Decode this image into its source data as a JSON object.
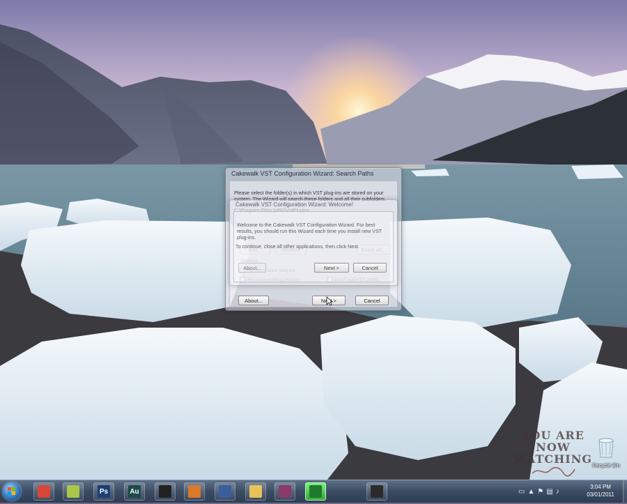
{
  "colors": {
    "sky_top": "#8a86b5",
    "sky_glow": "#f7e6c8",
    "lake": "#6f9199",
    "ice": "#e9f2f8",
    "taskbar": "#3b4c63",
    "active_task": "#4cc04f"
  },
  "wizard_back": {
    "title": "Cakewalk VST Configuration Wizard: Search Paths",
    "instructions": "Please select the folder(s) in which VST plug-ins are stored on your system. The Wizard will search these folders and all their subfolders.",
    "path_value": "C:\\Program Files (x86)\\VstPlugins",
    "add_label": "Add...",
    "remove_label": "Remove",
    "reset_label": "Reset all...",
    "options_group_label": "Options",
    "option_rescan_failed": "Re-scan failed plug-ins",
    "option_rescan_existing": "Re-scan existing plug-ins",
    "option_no_vst_prefix": "Don't add VST prefix",
    "about_label": "About...",
    "next_label": "Next >",
    "cancel_label": "Cancel"
  },
  "wizard_front": {
    "title": "Cakewalk VST Configuration Wizard: Welcome!",
    "welcome_text": "Welcome to the Cakewalk VST Configuration Wizard. For best results, you should run this Wizard each time you install new VST plug-ins.",
    "continue_text": "To continue, close all other applications, then click Next.",
    "about_label": "About...",
    "next_label": "Next >",
    "cancel_label": "Cancel"
  },
  "desktop": {
    "recycle_bin_label": "Recycle Bin",
    "watermark_line1": "YOU ARE NOW",
    "watermark_line2": "WATCHING"
  },
  "taskbar": {
    "apps": [
      {
        "name": "chrome-icon",
        "glyph": "",
        "color": "#d9463a"
      },
      {
        "name": "notepad-icon",
        "glyph": "",
        "color": "#a9c64a"
      },
      {
        "name": "photoshop-icon",
        "glyph": "Ps",
        "color": "#1c3f74"
      },
      {
        "name": "audition-icon",
        "glyph": "Au",
        "color": "#1d4a4a"
      },
      {
        "name": "terminal-icon",
        "glyph": "",
        "color": "#222222"
      },
      {
        "name": "sonar-icon",
        "glyph": "",
        "color": "#d9792b"
      },
      {
        "name": "recycle-app-icon",
        "glyph": "",
        "color": "#3a5e9e"
      },
      {
        "name": "folder-icon",
        "glyph": "",
        "color": "#e8c35a"
      },
      {
        "name": "winrar-icon",
        "glyph": "",
        "color": "#8a3a6a"
      },
      {
        "name": "camtasia-icon",
        "glyph": "",
        "color": "#1f7a2e"
      },
      {
        "name": "app-icon",
        "glyph": "",
        "color": "#2b2b2b"
      }
    ],
    "clock_time": "3:04 PM",
    "clock_date": "03/01/2011"
  }
}
